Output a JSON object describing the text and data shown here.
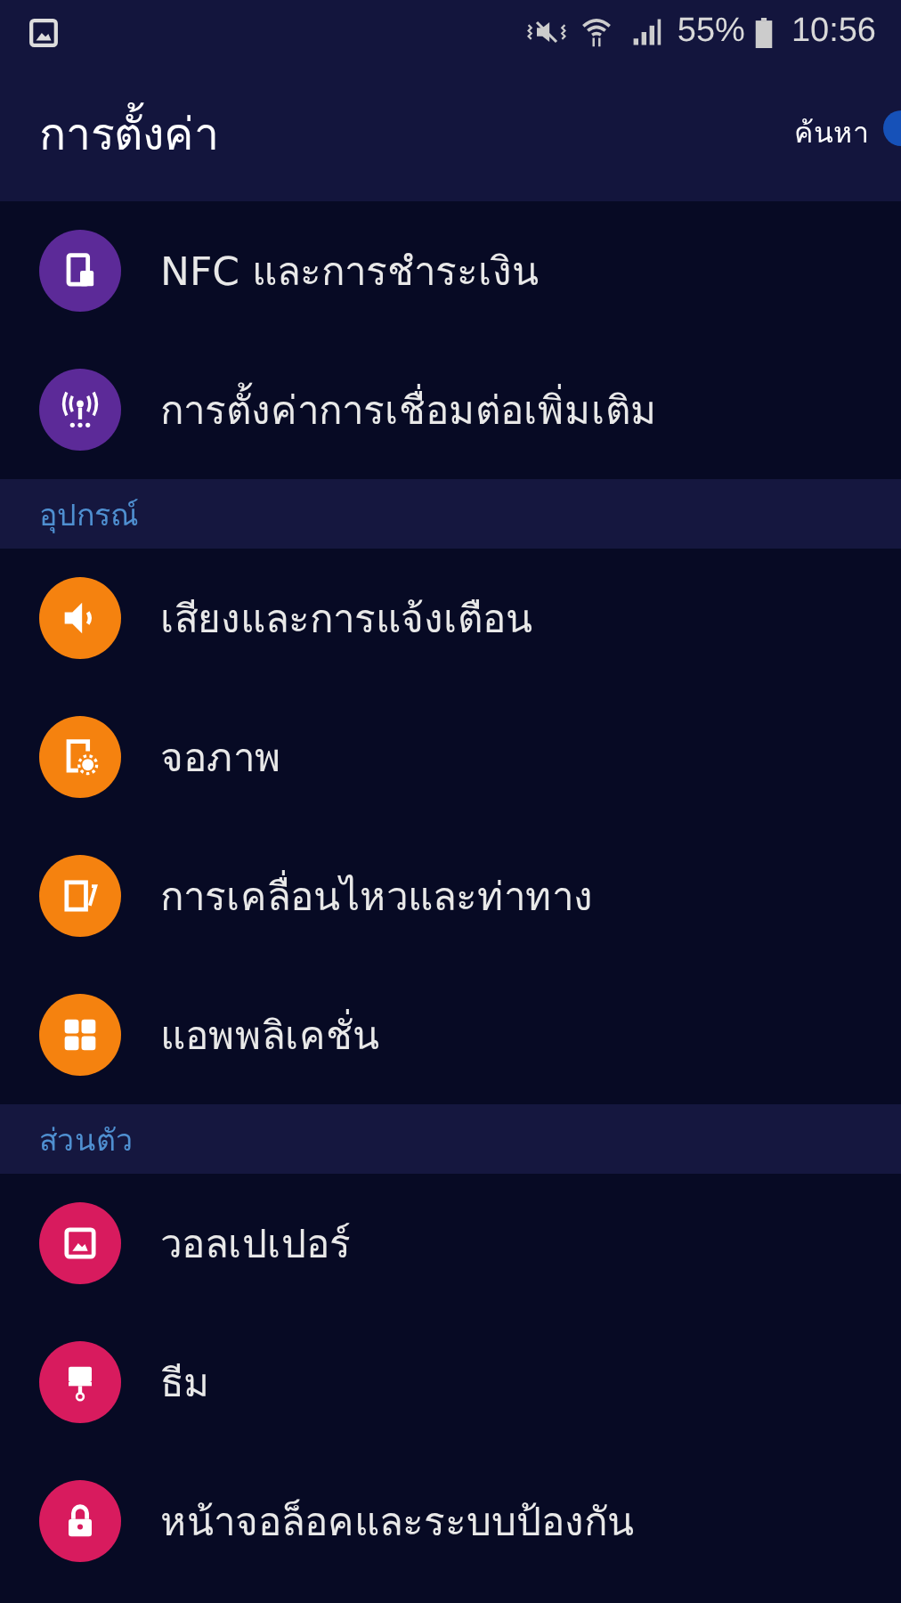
{
  "status_bar": {
    "battery": "55%",
    "time": "10:56"
  },
  "header": {
    "title": "การตั้งค่า",
    "search": "ค้นหา"
  },
  "sections": [
    {
      "items": [
        {
          "label": "NFC และการชำระเงิน",
          "color": "#5c2a98"
        },
        {
          "label": "การตั้งค่าการเชื่อมต่อเพิ่มเติม",
          "color": "#5c2a98"
        }
      ]
    },
    {
      "title": "อุปกรณ์",
      "items": [
        {
          "label": "เสียงและการแจ้งเตือน",
          "color": "#f5820f"
        },
        {
          "label": "จอภาพ",
          "color": "#f5820f"
        },
        {
          "label": "การเคลื่อนไหวและท่าทาง",
          "color": "#f5820f"
        },
        {
          "label": "แอพพลิเคชั่น",
          "color": "#f5820f"
        }
      ]
    },
    {
      "title": "ส่วนตัว",
      "items": [
        {
          "label": "วอลเปเปอร์",
          "color": "#d81b5e"
        },
        {
          "label": "ธีม",
          "color": "#d81b5e"
        },
        {
          "label": "หน้าจอล็อคและระบบป้องกัน",
          "color": "#d81b5e"
        }
      ]
    }
  ]
}
